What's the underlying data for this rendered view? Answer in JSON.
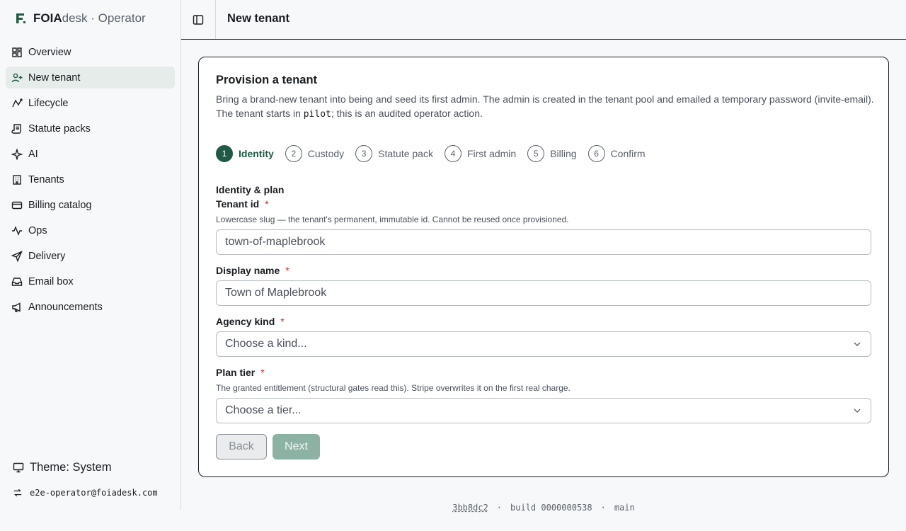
{
  "brand": {
    "strong": "FOIA",
    "rest": "desk · Operator"
  },
  "nav": [
    {
      "label": "Overview",
      "icon": "grid-icon",
      "active": false
    },
    {
      "label": "New tenant",
      "icon": "user-plus-icon",
      "active": true
    },
    {
      "label": "Lifecycle",
      "icon": "lifecycle-icon",
      "active": false
    },
    {
      "label": "Statute packs",
      "icon": "scroll-icon",
      "active": false
    },
    {
      "label": "AI",
      "icon": "sparkle-icon",
      "active": false
    },
    {
      "label": "Tenants",
      "icon": "building-icon",
      "active": false
    },
    {
      "label": "Billing catalog",
      "icon": "credit-card-icon",
      "active": false
    },
    {
      "label": "Ops",
      "icon": "activity-icon",
      "active": false
    },
    {
      "label": "Delivery",
      "icon": "send-icon",
      "active": false
    },
    {
      "label": "Email box",
      "icon": "inbox-icon",
      "active": false
    },
    {
      "label": "Announcements",
      "icon": "megaphone-icon",
      "active": false
    }
  ],
  "theme": {
    "label": "Theme: System"
  },
  "user": {
    "email": "e2e-operator@foiadesk.com"
  },
  "header": {
    "title": "New tenant"
  },
  "card": {
    "title": "Provision a tenant",
    "desc_part1": "Bring a brand-new tenant into being and seed its first admin. The admin is created in the tenant pool and emailed a temporary password (invite-email). The tenant starts in ",
    "desc_code": "pilot",
    "desc_part2": "; this is an audited operator action."
  },
  "steps": [
    {
      "num": "1",
      "label": "Identity",
      "active": true
    },
    {
      "num": "2",
      "label": "Custody",
      "active": false
    },
    {
      "num": "3",
      "label": "Statute pack",
      "active": false
    },
    {
      "num": "4",
      "label": "First admin",
      "active": false
    },
    {
      "num": "5",
      "label": "Billing",
      "active": false
    },
    {
      "num": "6",
      "label": "Confirm",
      "active": false
    }
  ],
  "form": {
    "section_title": "Identity & plan",
    "required_mark": "*",
    "tenant_id": {
      "label": "Tenant id",
      "help": "Lowercase slug — the tenant's permanent, immutable id. Cannot be reused once provisioned.",
      "placeholder": "town-of-maplebrook"
    },
    "display_name": {
      "label": "Display name",
      "placeholder": "Town of Maplebrook"
    },
    "agency_kind": {
      "label": "Agency kind",
      "placeholder": "Choose a kind..."
    },
    "plan_tier": {
      "label": "Plan tier",
      "help": "The granted entitlement (structural gates read this). Stripe overwrites it on the first real charge.",
      "placeholder": "Choose a tier..."
    },
    "back_label": "Back",
    "next_label": "Next"
  },
  "footer": {
    "sha": "3bb8dc2",
    "build": "build 0000000538",
    "branch": "main",
    "separator": "·"
  },
  "colors": {
    "accent": "#1e5b44",
    "active_bg": "#e6ece9",
    "required": "#c62828"
  }
}
